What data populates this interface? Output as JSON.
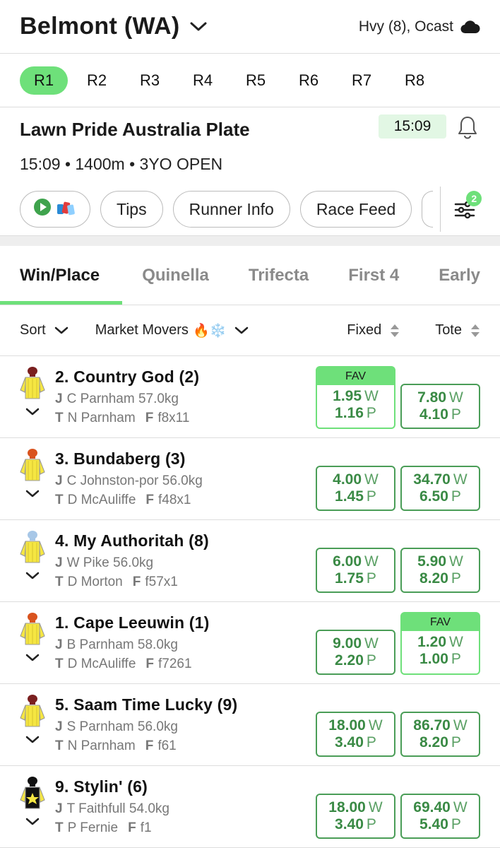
{
  "header": {
    "venue": "Belmont (WA)",
    "weather": "Hvy (8), Ocast",
    "weather_icon": "cloud-icon"
  },
  "races": [
    "R1",
    "R2",
    "R3",
    "R4",
    "R5",
    "R6",
    "R7",
    "R8"
  ],
  "race": {
    "title": "Lawn Pride Australia Plate",
    "time_badge": "15:09",
    "details": "15:09 • 1400m • 3YO OPEN"
  },
  "chips": {
    "tips": "Tips",
    "runner_info": "Runner Info",
    "race_feed": "Race Feed",
    "filter_count": "2"
  },
  "bet_tabs": [
    "Win/Place",
    "Quinella",
    "Trifecta",
    "First 4",
    "Early"
  ],
  "sort_bar": {
    "sort": "Sort",
    "market_movers": "Market Movers",
    "market_emoji": "🔥❄️",
    "fixed": "Fixed",
    "tote": "Tote"
  },
  "fav_label": "FAV",
  "labels": {
    "win": "W",
    "place": "P",
    "jockey": "J",
    "trainer": "T",
    "form": "F"
  },
  "runners": [
    {
      "name": "2. Country God (2)",
      "jockey": "C Parnham 57.0kg",
      "trainer": "N Parnham",
      "form": "f8x11",
      "fixed_win": "1.95",
      "fixed_place": "1.16",
      "tote_win": "7.80",
      "tote_place": "4.10",
      "fav": "fixed"
    },
    {
      "name": "3. Bundaberg (3)",
      "jockey": "C Johnston-por 56.0kg",
      "trainer": "D McAuliffe",
      "form": "f48x1",
      "fixed_win": "4.00",
      "fixed_place": "1.45",
      "tote_win": "34.70",
      "tote_place": "6.50",
      "fav": ""
    },
    {
      "name": "4. My Authoritah (8)",
      "jockey": "W Pike 56.0kg",
      "trainer": "D Morton",
      "form": "f57x1",
      "fixed_win": "6.00",
      "fixed_place": "1.75",
      "tote_win": "5.90",
      "tote_place": "8.20",
      "fav": ""
    },
    {
      "name": "1. Cape Leeuwin (1)",
      "jockey": "B Parnham 58.0kg",
      "trainer": "D McAuliffe",
      "form": "f7261",
      "fixed_win": "9.00",
      "fixed_place": "2.20",
      "tote_win": "1.20",
      "tote_place": "1.00",
      "fav": "tote"
    },
    {
      "name": "5. Saam Time Lucky (9)",
      "jockey": "S Parnham 56.0kg",
      "trainer": "N Parnham",
      "form": "f61",
      "fixed_win": "18.00",
      "fixed_place": "3.40",
      "tote_win": "86.70",
      "tote_place": "8.20",
      "fav": ""
    },
    {
      "name": "9. Stylin' (6)",
      "jockey": "T Faithfull 54.0kg",
      "trainer": "P Fernie",
      "form": "f1",
      "fixed_win": "18.00",
      "fixed_place": "3.40",
      "tote_win": "69.40",
      "tote_place": "5.40",
      "fav": ""
    }
  ],
  "colors": {
    "accent": "#6ee07a",
    "odds_green": "#3a8a45"
  }
}
